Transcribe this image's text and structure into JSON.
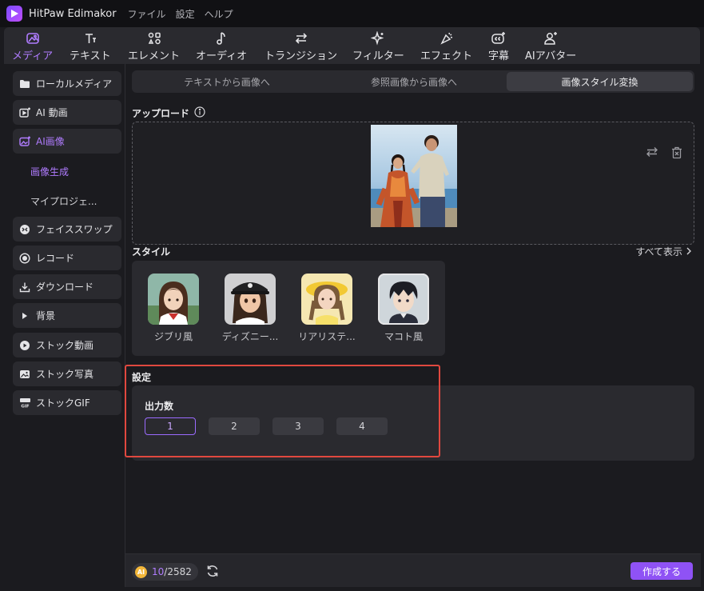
{
  "app": {
    "title": "HitPaw Edimakor",
    "menu": [
      "ファイル",
      "設定",
      "ヘルプ"
    ]
  },
  "toolbar": {
    "tabs": [
      {
        "label": "メディア",
        "icon": "media-icon",
        "active": true
      },
      {
        "label": "テキスト",
        "icon": "text-icon"
      },
      {
        "label": "エレメント",
        "icon": "elements-icon"
      },
      {
        "label": "オーディオ",
        "icon": "audio-icon"
      },
      {
        "label": "トランジション",
        "icon": "transition-icon"
      },
      {
        "label": "フィルター",
        "icon": "filter-icon"
      },
      {
        "label": "エフェクト",
        "icon": "effect-icon"
      },
      {
        "label": "字幕",
        "icon": "subtitle-icon"
      },
      {
        "label": "AIアバター",
        "icon": "avatar-icon"
      }
    ]
  },
  "sidebar": {
    "items": [
      {
        "label": "ローカルメディア",
        "icon": "folder-icon"
      },
      {
        "label": "AI 動画",
        "icon": "ai-video-icon"
      },
      {
        "label": "AI画像",
        "icon": "ai-image-icon",
        "active": true
      },
      {
        "label": "フェイススワップ",
        "icon": "face-swap-icon"
      },
      {
        "label": "レコード",
        "icon": "record-icon"
      },
      {
        "label": "ダウンロード",
        "icon": "download-icon"
      },
      {
        "label": "背景",
        "icon": "caret-right-icon"
      },
      {
        "label": "ストック動画",
        "icon": "stock-video-icon"
      },
      {
        "label": "ストック写真",
        "icon": "stock-photo-icon"
      },
      {
        "label": "ストックGIF",
        "icon": "gif-icon"
      }
    ],
    "subitems": [
      {
        "label": "画像生成",
        "active": true
      },
      {
        "label": "マイプロジェ..."
      }
    ]
  },
  "main": {
    "subtabs": [
      {
        "label": "テキストから画像へ"
      },
      {
        "label": "参照画像から画像へ"
      },
      {
        "label": "画像スタイル変換",
        "active": true
      }
    ],
    "upload": {
      "title": "アップロード"
    },
    "style": {
      "title": "スタイル",
      "show_all": "すべて表示",
      "styles": [
        {
          "name": "ジブリ風"
        },
        {
          "name": "ディズニー..."
        },
        {
          "name": "リアリステ..."
        },
        {
          "name": "マコト風"
        }
      ]
    },
    "settings": {
      "title": "設定",
      "output_label": "出力数",
      "options": [
        "1",
        "2",
        "3",
        "4"
      ],
      "selected": "1"
    },
    "footer": {
      "coin_label": "AI",
      "credits_used": "10",
      "credits_total": "/2582",
      "create_label": "作成する"
    }
  },
  "colors": {
    "accent": "#8f52f5",
    "accent_text": "#b07cff",
    "highlight": "#e0483f",
    "background": "#1b1b1f",
    "panel": "#2a2a2f"
  }
}
